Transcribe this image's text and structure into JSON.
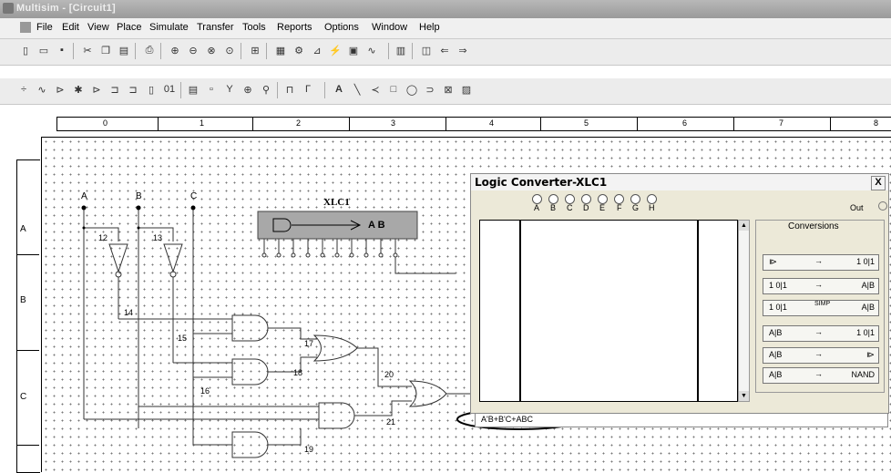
{
  "window": {
    "title": "Multisim - [Circuit1]"
  },
  "menu": [
    "File",
    "Edit",
    "View",
    "Place",
    "Simulate",
    "Transfer",
    "Tools",
    "Reports",
    "Options",
    "Window",
    "Help"
  ],
  "toolbar": {
    "help_label": "?"
  },
  "ruler": {
    "cols": [
      "0",
      "1",
      "2",
      "3",
      "4",
      "5",
      "6",
      "7",
      "8"
    ],
    "rows": [
      "A",
      "B",
      "C"
    ]
  },
  "circuit": {
    "inputs": [
      "A",
      "B",
      "C"
    ],
    "instrument_label": "XLC1",
    "instrument_output": "A B",
    "node_labels": [
      "12",
      "13",
      "14",
      "15",
      "16",
      "17",
      "18",
      "19",
      "20",
      "21"
    ]
  },
  "logic_converter": {
    "title": "Logic Converter-XLC1",
    "close_label": "X",
    "inputs": [
      "A",
      "B",
      "C",
      "D",
      "E",
      "F",
      "G",
      "H"
    ],
    "out_label": "Out",
    "conversions_label": "Conversions",
    "buttons": [
      {
        "left": "⧐",
        "arrow": "→",
        "right": "1 0|1"
      },
      {
        "left": "1 0|1",
        "arrow": "→",
        "right": "A|B"
      },
      {
        "left": "1 0|1",
        "arrow": "SIMP",
        "right": "A|B"
      },
      {
        "left": "A|B",
        "arrow": "→",
        "right": "1 0|1"
      },
      {
        "left": "A|B",
        "arrow": "→",
        "right": "⧐"
      },
      {
        "left": "A|B",
        "arrow": "→",
        "right": "NAND"
      }
    ],
    "expression": "A'B+B'C+ABC"
  },
  "colors": {
    "accent": "#000000",
    "background": "#ffffff",
    "panel": "#ece9d8"
  }
}
